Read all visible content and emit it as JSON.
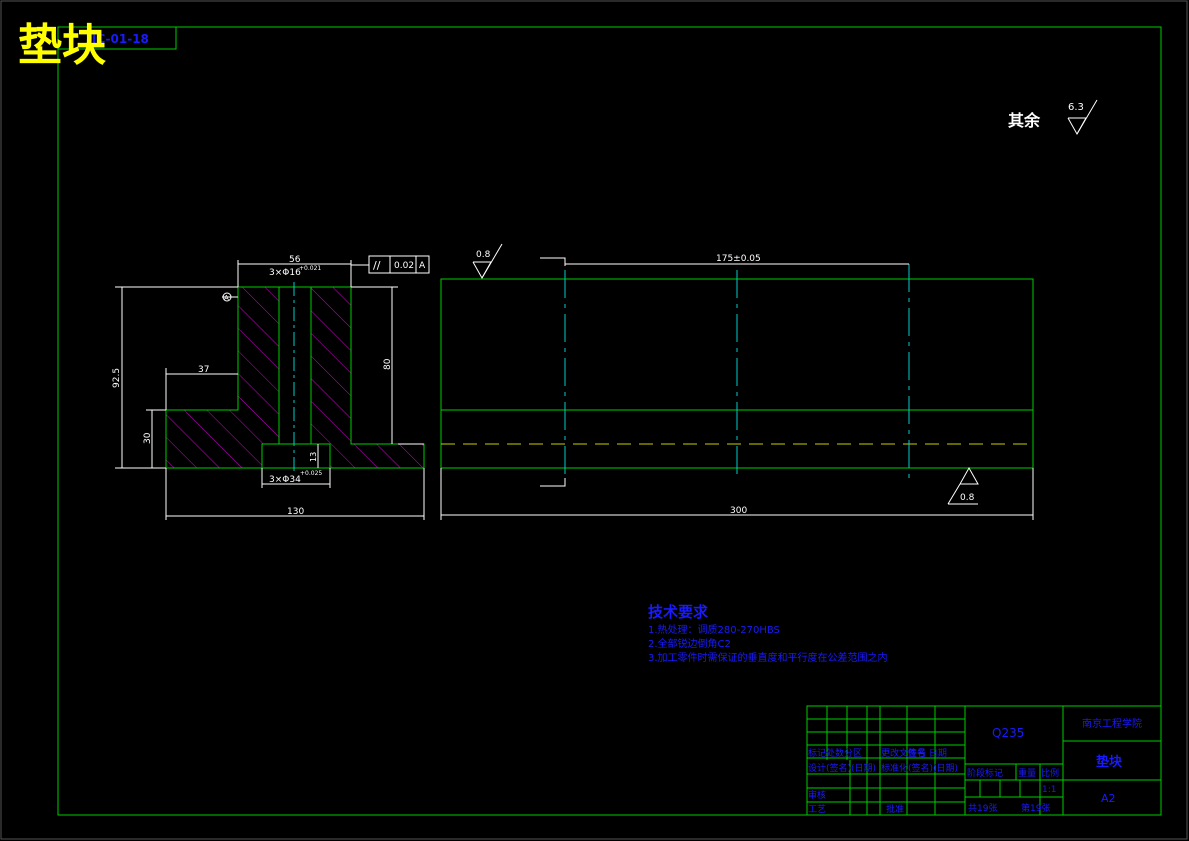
{
  "colors": {
    "background": "#000000",
    "frame": "#00cc00",
    "title_yellow": "#ffff00",
    "blue": "#1a1aff",
    "white": "#ffffff",
    "cyan": "#00cccc",
    "magenta": "#cc00cc",
    "hidden_line": "#cccc00"
  },
  "header": {
    "big_title": "垫块",
    "drawing_code": "JC-01-18"
  },
  "roughness": {
    "rest_label": "其余",
    "rest_value": "6.3",
    "top_value": "0.8",
    "bottom_value": "0.8"
  },
  "tolerance_frame": {
    "symbol": "//",
    "value": "0.02",
    "datum": "A"
  },
  "left_view": {
    "datum_label": "A",
    "dims": {
      "top_width": "56",
      "hole_top": "3×Φ16",
      "hole_top_tol": "+0.021",
      "height_left": "92.5",
      "step": "37",
      "base_height": "30",
      "right_height": "80",
      "counterbore_depth": "13",
      "hole_bottom": "3×Φ34",
      "hole_bottom_tol": "+0.025",
      "overall_width": "130"
    }
  },
  "right_view": {
    "dims": {
      "spacing": "175±0.05",
      "length": "300"
    }
  },
  "tech_req": {
    "title": "技术要求",
    "items": [
      "1.热处理：调质280-270HBS",
      "2.全部锐边倒角C2",
      "3.加工零件时需保证的垂直度和平行度在公差范围之内"
    ]
  },
  "title_block": {
    "material": "Q235",
    "school": "南京工程学院",
    "part_name": "垫块",
    "sheet_size": "A2",
    "scale": "1:1",
    "total_sheets": "共19张",
    "sheet_no": "第19张",
    "row_labels": {
      "r1": "标记处数分区",
      "r1b": "更改文件号",
      "r1c": "签名 日期",
      "r2": "设计(签名)(日期)",
      "r2b": "标准化(签名)(日期)",
      "r3": "审核",
      "r3b": "批准",
      "r4": "工艺",
      "stage_mark": "阶段标记",
      "weight": "重量",
      "ratio": "比例"
    }
  }
}
